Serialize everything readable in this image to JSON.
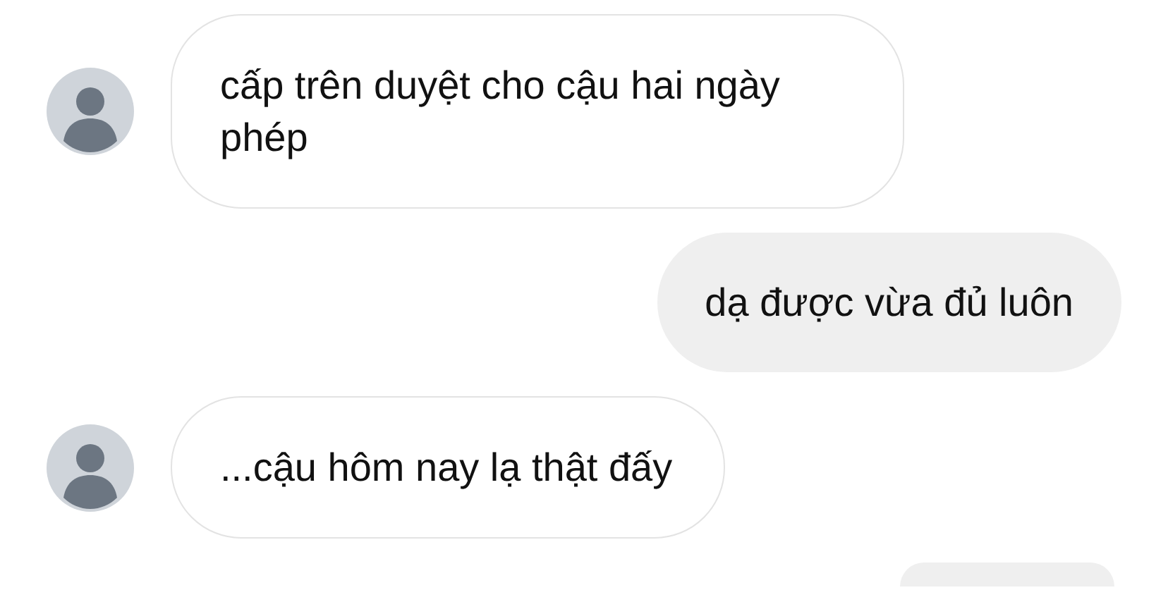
{
  "messages": [
    {
      "kind": "incoming",
      "text": "cấp trên duyệt cho cậu hai ngày phép"
    },
    {
      "kind": "outgoing",
      "text": "dạ được vừa đủ luôn"
    },
    {
      "kind": "incoming",
      "text": "...cậu hôm nay lạ thật đấy"
    },
    {
      "kind": "partial"
    }
  ]
}
